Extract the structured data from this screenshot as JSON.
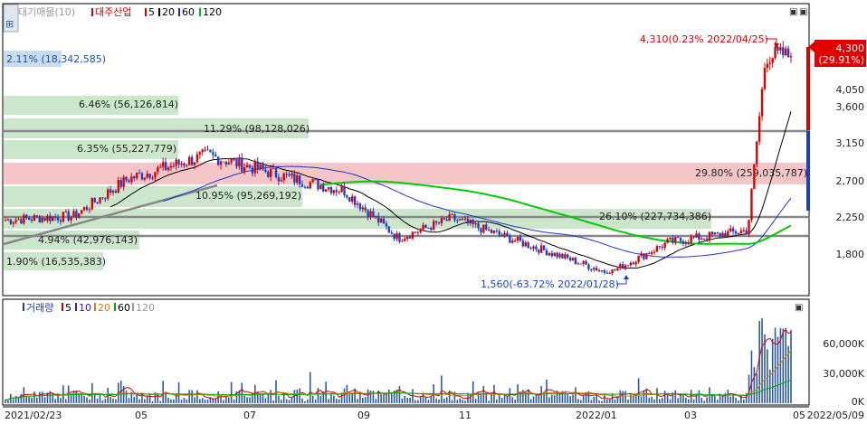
{
  "price_panel": {
    "legend": [
      {
        "label": "대기매물(10)",
        "color": "#9a9a9a"
      },
      {
        "label": "대주산업",
        "color": "#d40000"
      },
      {
        "label": "5",
        "color": "#000000"
      },
      {
        "label": "20",
        "color": "#000000"
      },
      {
        "label": "60",
        "color": "#000000"
      },
      {
        "label": "120",
        "color": "#00bb00"
      }
    ],
    "corner_icons": [
      "▣",
      "▣"
    ],
    "current_price": "4,300",
    "current_change": "(29.91%)",
    "high_annotation": "4,310(0.23% 2022/04/25)",
    "low_annotation": "1,560(-63.72% 2022/01/28)",
    "volume_profile_labels": [
      "2.11% (18,342,585)",
      "6.46% (56,126,814)",
      "11.29% (98,128,026)",
      "6.35% (55,227,779)",
      "29.80% (259,035,787)",
      "10.95% (95,269,192)",
      "26.10% (227,734,386)",
      "4.94% (42,976,143)",
      "1.90% (16,535,383)"
    ]
  },
  "volume_panel": {
    "legend": [
      {
        "label": "거래량",
        "color": "#1f3f8f"
      },
      {
        "label": "5",
        "color": "#d40000"
      },
      {
        "label": "10",
        "color": "#2020cc"
      },
      {
        "label": "20",
        "color": "#d08000"
      },
      {
        "label": "60",
        "color": "#00aa00"
      },
      {
        "label": "120",
        "color": "#999999"
      }
    ],
    "corner_icon": "▣"
  },
  "x_axis": {
    "labels": [
      "2021/02/23",
      "05",
      "07",
      "09",
      "11",
      "2022/01",
      "03",
      "05",
      "2022/05/09"
    ]
  },
  "colors": {
    "up": "#e00000",
    "down": "#1a3fcf",
    "profile_green": "#cce6cc",
    "profile_red": "#f5c6c8",
    "profile_blue": "#c9dcf0"
  },
  "chart_data": [
    {
      "type": "candlestick",
      "title": "대주산업",
      "x_range": [
        "2021/02/23",
        "2022/05/09"
      ],
      "y_ticks": [
        1800,
        2250,
        2700,
        3150,
        3600,
        4050
      ],
      "y_tick_labels": [
        "1,800",
        "2,250",
        "2,700",
        "3,150",
        "3,600",
        "4,050"
      ],
      "ylim": [
        1400,
        4550
      ],
      "price_series_approx": [
        {
          "date": "2021/02/23",
          "close": 2230
        },
        {
          "date": "2021/04",
          "close": 2280
        },
        {
          "date": "2021/05/01",
          "close": 2750
        },
        {
          "date": "2021/06/15",
          "close": 3050
        },
        {
          "date": "2021/08",
          "close": 2760
        },
        {
          "date": "2021/09",
          "close": 2600
        },
        {
          "date": "2021/10",
          "close": 2000
        },
        {
          "date": "2021/11",
          "close": 2250
        },
        {
          "date": "2022/01/28",
          "close": 1560
        },
        {
          "date": "2022/03",
          "close": 1950
        },
        {
          "date": "2022/04/15",
          "close": 2100
        },
        {
          "date": "2022/04/25",
          "close": 4310
        },
        {
          "date": "2022/05/09",
          "close": 4300
        }
      ],
      "high": {
        "value": 4310,
        "label": "4,310(0.23% 2022/04/25)"
      },
      "low": {
        "value": 1560,
        "label": "1,560(-63.72% 2022/01/28)"
      },
      "current": {
        "value": 4300,
        "change_pct": 29.91
      }
    },
    {
      "type": "bar",
      "title": "거래량",
      "y_ticks": [
        0,
        30000,
        60000
      ],
      "y_tick_labels": [
        "0K",
        "30,000K",
        "60,000K"
      ],
      "ylim": [
        0,
        90000
      ]
    }
  ]
}
